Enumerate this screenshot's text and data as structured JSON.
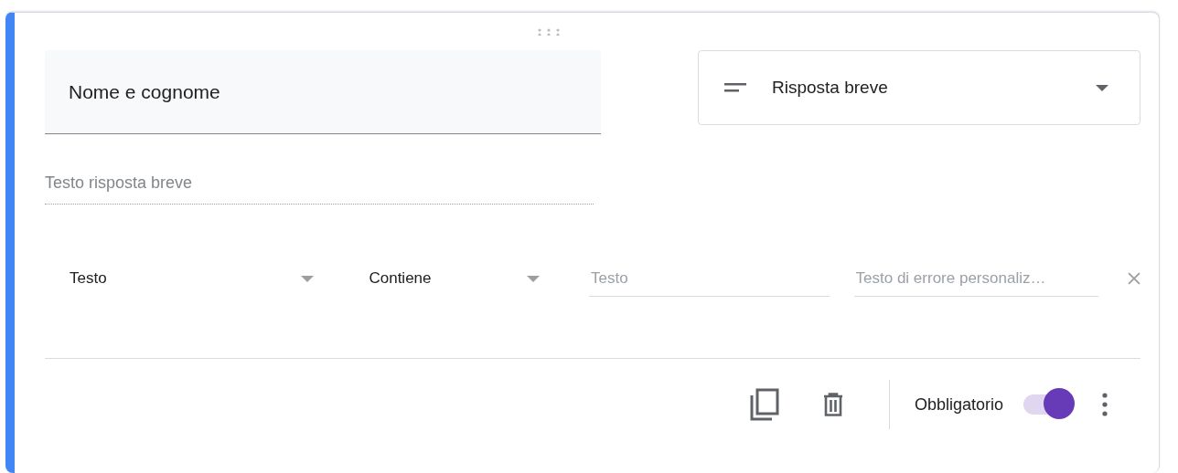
{
  "question": {
    "title": "Nome e cognome",
    "type": {
      "label": "Risposta breve"
    },
    "answer_placeholder": "Testo risposta breve",
    "validation": {
      "kind_select": "Testo",
      "condition_select": "Contiene",
      "value": {
        "placeholder": "Testo"
      },
      "error": {
        "placeholder": "Testo di errore personaliz…"
      }
    },
    "required": {
      "label": "Obbligatorio",
      "on": true
    }
  }
}
